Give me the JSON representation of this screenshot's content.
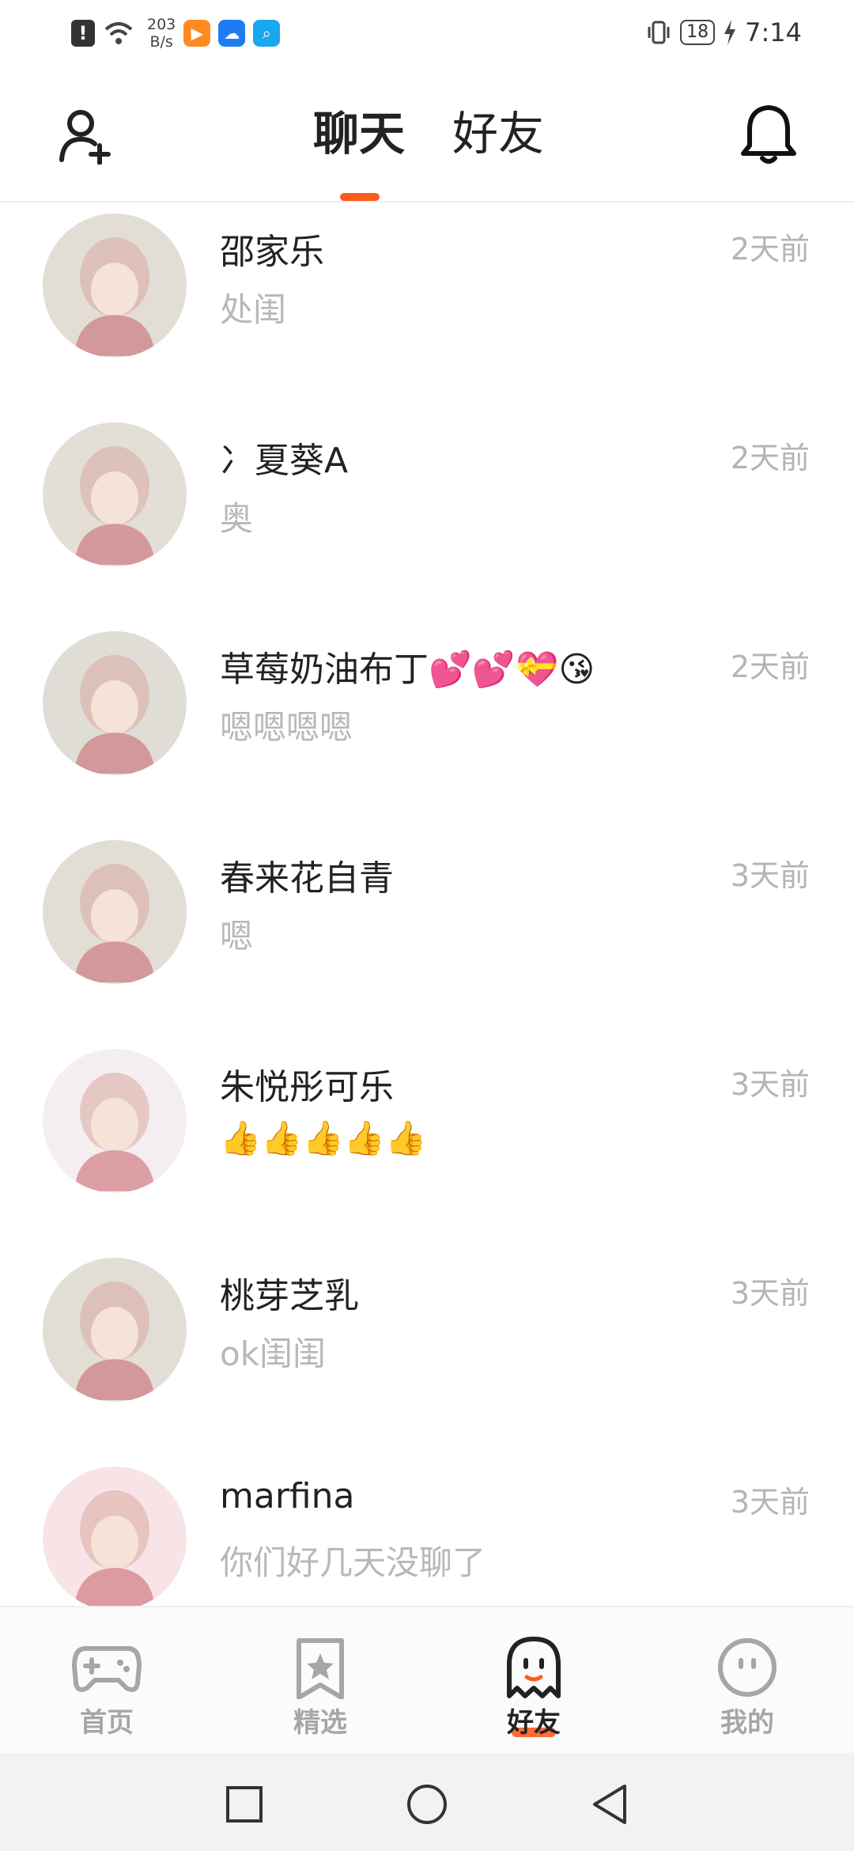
{
  "status_bar": {
    "net_speed_value": "203",
    "net_speed_unit": "B/s",
    "battery": "18",
    "time": "7:14"
  },
  "header": {
    "tabs": [
      {
        "label": "聊天",
        "active": true
      },
      {
        "label": "好友",
        "active": false
      }
    ],
    "accent_color": "#ff5a1f"
  },
  "chats": [
    {
      "name": "邵家乐",
      "message": "处闺",
      "time": "2天前",
      "avatar_color": "#e2ded6"
    },
    {
      "name": "冫夏葵A",
      "message": "奥",
      "time": "2天前",
      "avatar_color": "#e3dfd7"
    },
    {
      "name": "草莓奶油布丁💕💕💝😘",
      "message": "嗯嗯嗯嗯",
      "time": "2天前",
      "avatar_color": "#e0ddd6"
    },
    {
      "name": "春来花自青",
      "message": "嗯",
      "time": "3天前",
      "avatar_color": "#e2ded6"
    },
    {
      "name": "朱悦彤可乐",
      "message": "👍👍👍👍👍",
      "time": "3天前",
      "avatar_color": "#f4eef0"
    },
    {
      "name": "桃芽芝乳",
      "message": "ok闺闺",
      "time": "3天前",
      "avatar_color": "#e2ded6"
    },
    {
      "name": "marfina",
      "message": "你们好几天没聊了",
      "time": "3天前",
      "avatar_color": "#f8e4e6"
    }
  ],
  "bottom_nav": [
    {
      "label": "首页",
      "icon": "gamepad-icon",
      "active": false
    },
    {
      "label": "精选",
      "icon": "star-bookmark-icon",
      "active": false
    },
    {
      "label": "好友",
      "icon": "ghost-icon",
      "active": true
    },
    {
      "label": "我的",
      "icon": "smiley-icon",
      "active": false
    }
  ]
}
